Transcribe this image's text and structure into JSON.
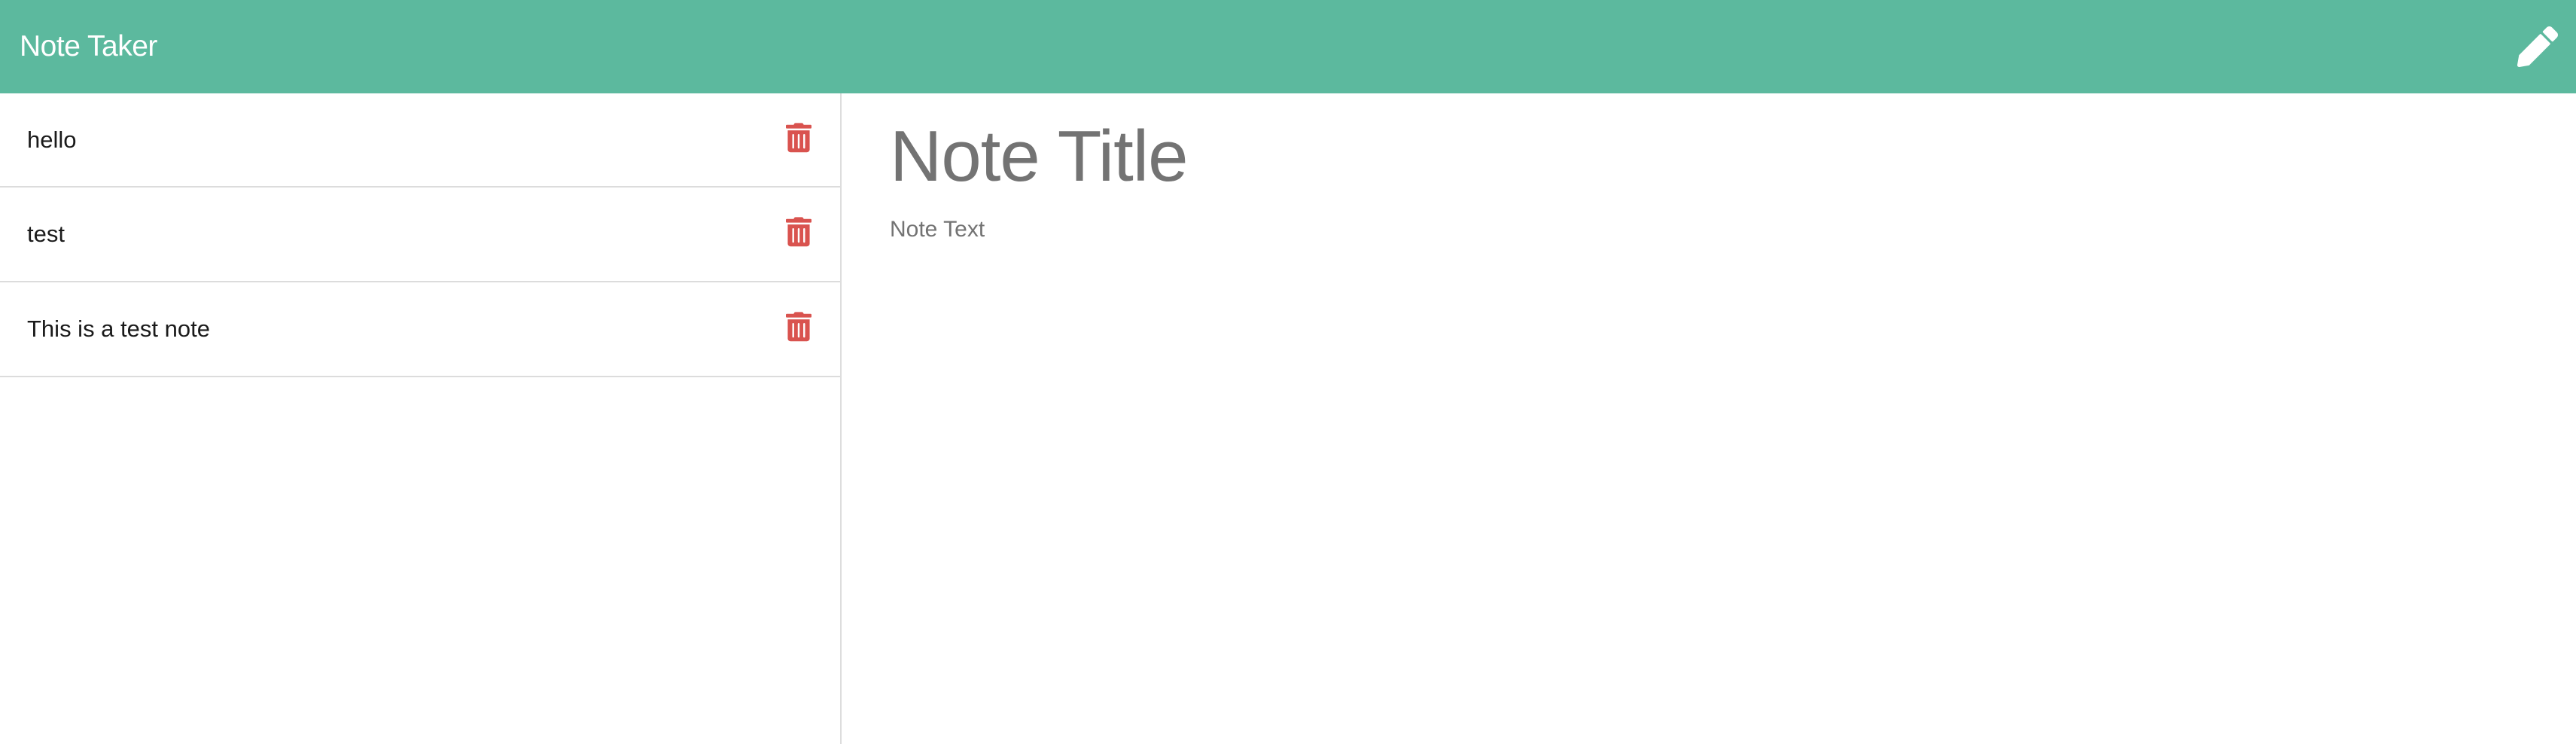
{
  "app": {
    "title": "Note Taker"
  },
  "header": {
    "new_note_icon": "pencil-icon"
  },
  "notes": [
    {
      "title": "hello",
      "delete_icon": "trash-icon"
    },
    {
      "title": "test",
      "delete_icon": "trash-icon"
    },
    {
      "title": "This is a test note",
      "delete_icon": "trash-icon"
    }
  ],
  "editor": {
    "title_placeholder": "Note Title",
    "text_placeholder": "Note Text"
  },
  "colors": {
    "navbar": "#5cb99e",
    "delete": "#d9534f",
    "placeholder": "#737373"
  }
}
